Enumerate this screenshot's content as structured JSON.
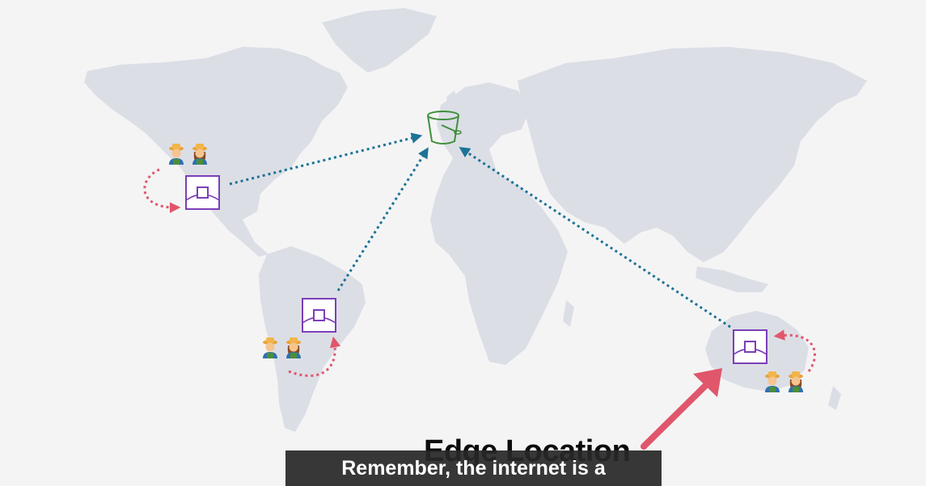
{
  "diagram": {
    "origin": {
      "icon": "s3-bucket-icon",
      "color": "#3f8f3a"
    },
    "edge_locations": [
      {
        "id": "north-america",
        "icon": "edge-location-icon"
      },
      {
        "id": "south-america",
        "icon": "edge-location-icon"
      },
      {
        "id": "australia",
        "icon": "edge-location-icon"
      }
    ],
    "user_groups": [
      {
        "id": "north-america-users",
        "icon": "farmer-users-icon"
      },
      {
        "id": "south-america-users",
        "icon": "farmer-users-icon"
      },
      {
        "id": "australia-users",
        "icon": "farmer-users-icon"
      }
    ],
    "colors": {
      "map": "#dcdee6",
      "origin_links": "#1c7396",
      "user_links": "#e0566b",
      "edge_location": "#7b3fb8",
      "pointer_arrow": "#e0566b"
    },
    "annotation": "Edge Location"
  },
  "video": {
    "caption": "Remember, the internet is a"
  }
}
